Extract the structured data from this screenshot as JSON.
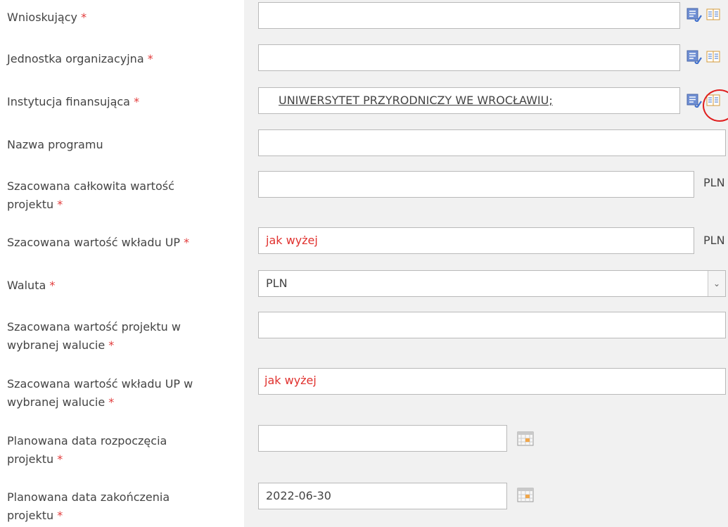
{
  "required_marker": "*",
  "fields": {
    "wnioskujacy": {
      "label": "Wnioskujący"
    },
    "jednostka": {
      "label": "Jednostka organizacyjna"
    },
    "instytucja": {
      "label": "Instytucja finansująca",
      "value": "UNIWERSYTET PRZYRODNICZY WE WROCŁAWIU;"
    },
    "nazwa_programu": {
      "label": "Nazwa programu"
    },
    "wartosc_calkowita": {
      "label_line1": "Szacowana całkowita wartość",
      "label_line2": "projektu",
      "unit": "PLN"
    },
    "wartosc_wkladu": {
      "label": "Szacowana wartość wkładu UP",
      "value": "jak wyżej",
      "unit": "PLN"
    },
    "waluta": {
      "label": "Waluta",
      "selected": "PLN"
    },
    "wartosc_waluta": {
      "label_line1": "Szacowana wartość projektu w",
      "label_line2": "wybranej walucie"
    },
    "wklad_waluta": {
      "label_line1": "Szacowana wartość wkładu UP w",
      "label_line2": "wybranej walucie",
      "value": "jak wyżej"
    },
    "data_rozpoczecia": {
      "label_line1": "Planowana data rozpoczęcia",
      "label_line2": "projektu"
    },
    "data_zakonczenia": {
      "label_line1": "Planowana data zakończenia",
      "label_line2": "projektu",
      "value": "2022-06-30"
    }
  },
  "icons": {
    "lookup_edit": "edit-list-icon",
    "lookup_book": "address-book-icon",
    "calendar": "calendar-icon",
    "dropdown": "chevron-down-icon"
  },
  "colors": {
    "required": "#e23b3b",
    "highlight_circle": "#e01e1e",
    "panel_bg": "#f1f1f1"
  }
}
